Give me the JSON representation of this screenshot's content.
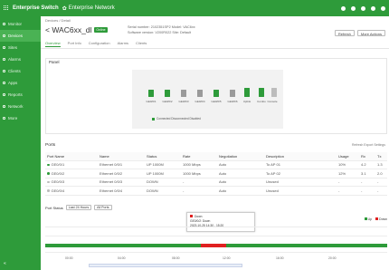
{
  "topbar": {
    "app_name": "Enterprise Switch",
    "brand": "Enterprise Network"
  },
  "sidebar": {
    "items": [
      {
        "label": "Monitor",
        "icon": "monitor-icon"
      },
      {
        "label": "Devices",
        "icon": "devices-icon"
      },
      {
        "label": "Sites",
        "icon": "sites-icon"
      },
      {
        "label": "Alarms",
        "icon": "alarm-icon"
      },
      {
        "label": "Clients",
        "icon": "clients-icon"
      },
      {
        "label": "Apps",
        "icon": "apps-icon"
      },
      {
        "label": "Reports",
        "icon": "reports-icon"
      },
      {
        "label": "Network",
        "icon": "network-icon"
      },
      {
        "label": "More",
        "icon": "more-icon"
      }
    ],
    "active_index": 1,
    "collapse_label": "«"
  },
  "header": {
    "breadcrumb": "Devices / Detail",
    "title": "< WAC6xx_dl",
    "badge": "Online",
    "meta_line1": "Serial number: 2102351SP2 Model: VAC6xx",
    "meta_line2": "Software version: V200R022 Site: Default",
    "btn_refresh": "Refresh",
    "btn_more": "More Actions"
  },
  "tabs": [
    "Overview",
    "Port Info",
    "Configuration",
    "Alarms",
    "Clients"
  ],
  "active_tab": 0,
  "diagram": {
    "label": "Panel",
    "ports": [
      {
        "label": "GE0/0/1",
        "color": "#2e9b3a"
      },
      {
        "label": "GE0/0/2",
        "color": "#2e9b3a"
      },
      {
        "label": "GE0/0/3",
        "color": "#9a9a9a"
      },
      {
        "label": "GE0/0/4",
        "color": "#9a9a9a"
      },
      {
        "label": "GE0/0/5",
        "color": "#2e9b3a"
      },
      {
        "label": "GE0/0/6",
        "color": "#9a9a9a"
      }
    ],
    "side_ports": [
      {
        "label": "Uplink",
        "color": "#2e9b3a"
      },
      {
        "label": "Combo",
        "color": "#2e9b3a"
      },
      {
        "label": "Console",
        "color": "#bcbcbc"
      }
    ],
    "legend": "Connected  Disconnected  Disabled"
  },
  "table": {
    "title": "Ports",
    "tools": "Refresh  Export  Settings",
    "headers": [
      "Port Name",
      "Name",
      "Status",
      "Rate",
      "Negotiation",
      "Description",
      "Usage",
      "Rx",
      "Tx"
    ],
    "rows": [
      [
        "GE0/0/1",
        "Ethernet 0/0/1",
        "UP 1000M",
        "1000 Mbps",
        "Auto",
        "To AP 01",
        "10%",
        "4.2",
        "1.3"
      ],
      [
        "GE0/0/2",
        "Ethernet 0/0/2",
        "UP 1000M",
        "1000 Mbps",
        "Auto",
        "To AP 02",
        "12%",
        "3.1",
        "2.0"
      ],
      [
        "GE0/0/3",
        "Ethernet 0/0/3",
        "DOWN",
        "-",
        "Auto",
        "Unused",
        "-",
        "-",
        "-"
      ],
      [
        "GE0/0/4",
        "Ethernet 0/0/4",
        "DOWN",
        "-",
        "Auto",
        "Unused",
        "-",
        "-",
        "-"
      ]
    ]
  },
  "chart": {
    "title": "Port Status",
    "select1": "Last 24 Hours",
    "select2": "All Ports",
    "tooltip_title": "Down",
    "tooltip_line1": "GE0/0/2: Down",
    "tooltip_line2": "2023-10-25 14:30 - 15:20",
    "legend": [
      {
        "label": "Up",
        "color": "#2e9b3a"
      },
      {
        "label": "Down",
        "color": "#e02020"
      }
    ],
    "xticks": [
      "00:00",
      "04:00",
      "08:00",
      "12:00",
      "16:00",
      "20:00"
    ]
  }
}
